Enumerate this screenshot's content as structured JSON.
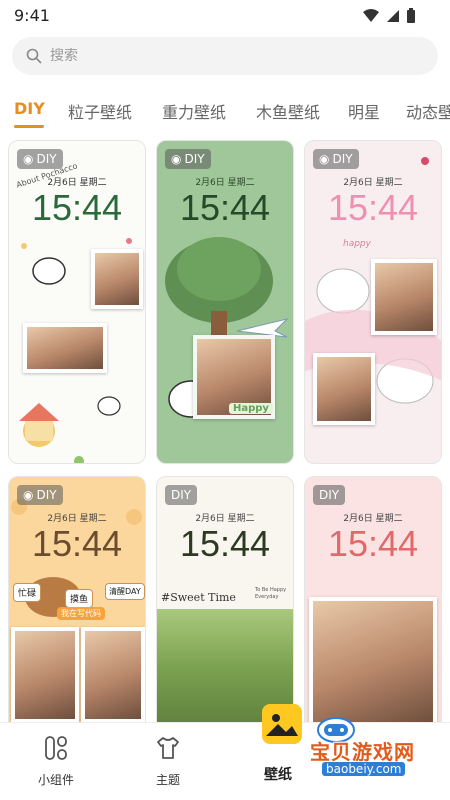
{
  "status": {
    "time": "9:41"
  },
  "search": {
    "placeholder": "搜索"
  },
  "tabs": [
    {
      "label": "DIY"
    },
    {
      "label": "粒子壁纸"
    },
    {
      "label": "重力壁纸"
    },
    {
      "label": "木鱼壁纸"
    },
    {
      "label": "明星"
    },
    {
      "label": "动态壁"
    }
  ],
  "cards": [
    {
      "badge": "DIY",
      "date": "2月6日 星期二",
      "clock": "15:44",
      "caption": "About Pochacco"
    },
    {
      "badge": "DIY",
      "date": "2月6日 星期二",
      "clock": "15:44",
      "caption": "Happy"
    },
    {
      "badge": "DIY",
      "date": "2月6日 星期二",
      "clock": "15:44",
      "caption": "happy"
    },
    {
      "badge": "DIY",
      "date": "2月6日 星期二",
      "clock": "15:44",
      "tags": [
        "忙碌",
        "摸鱼",
        "清醒DAY",
        "我在写代码"
      ]
    },
    {
      "badge": "DIY",
      "date": "2月6日 星期二",
      "clock": "15:44",
      "caption": "#Sweet Time",
      "note": "To Be Happy Everyday"
    },
    {
      "badge": "DIY",
      "date": "2月6日 星期二",
      "clock": "15:44"
    }
  ],
  "nav": {
    "widgets": "小组件",
    "theme": "主题",
    "wallpaper": "壁纸"
  },
  "watermark": {
    "main": "宝贝游戏网",
    "sub": "baobeiy.com"
  },
  "colors": {
    "accent": "#e88e1c"
  }
}
